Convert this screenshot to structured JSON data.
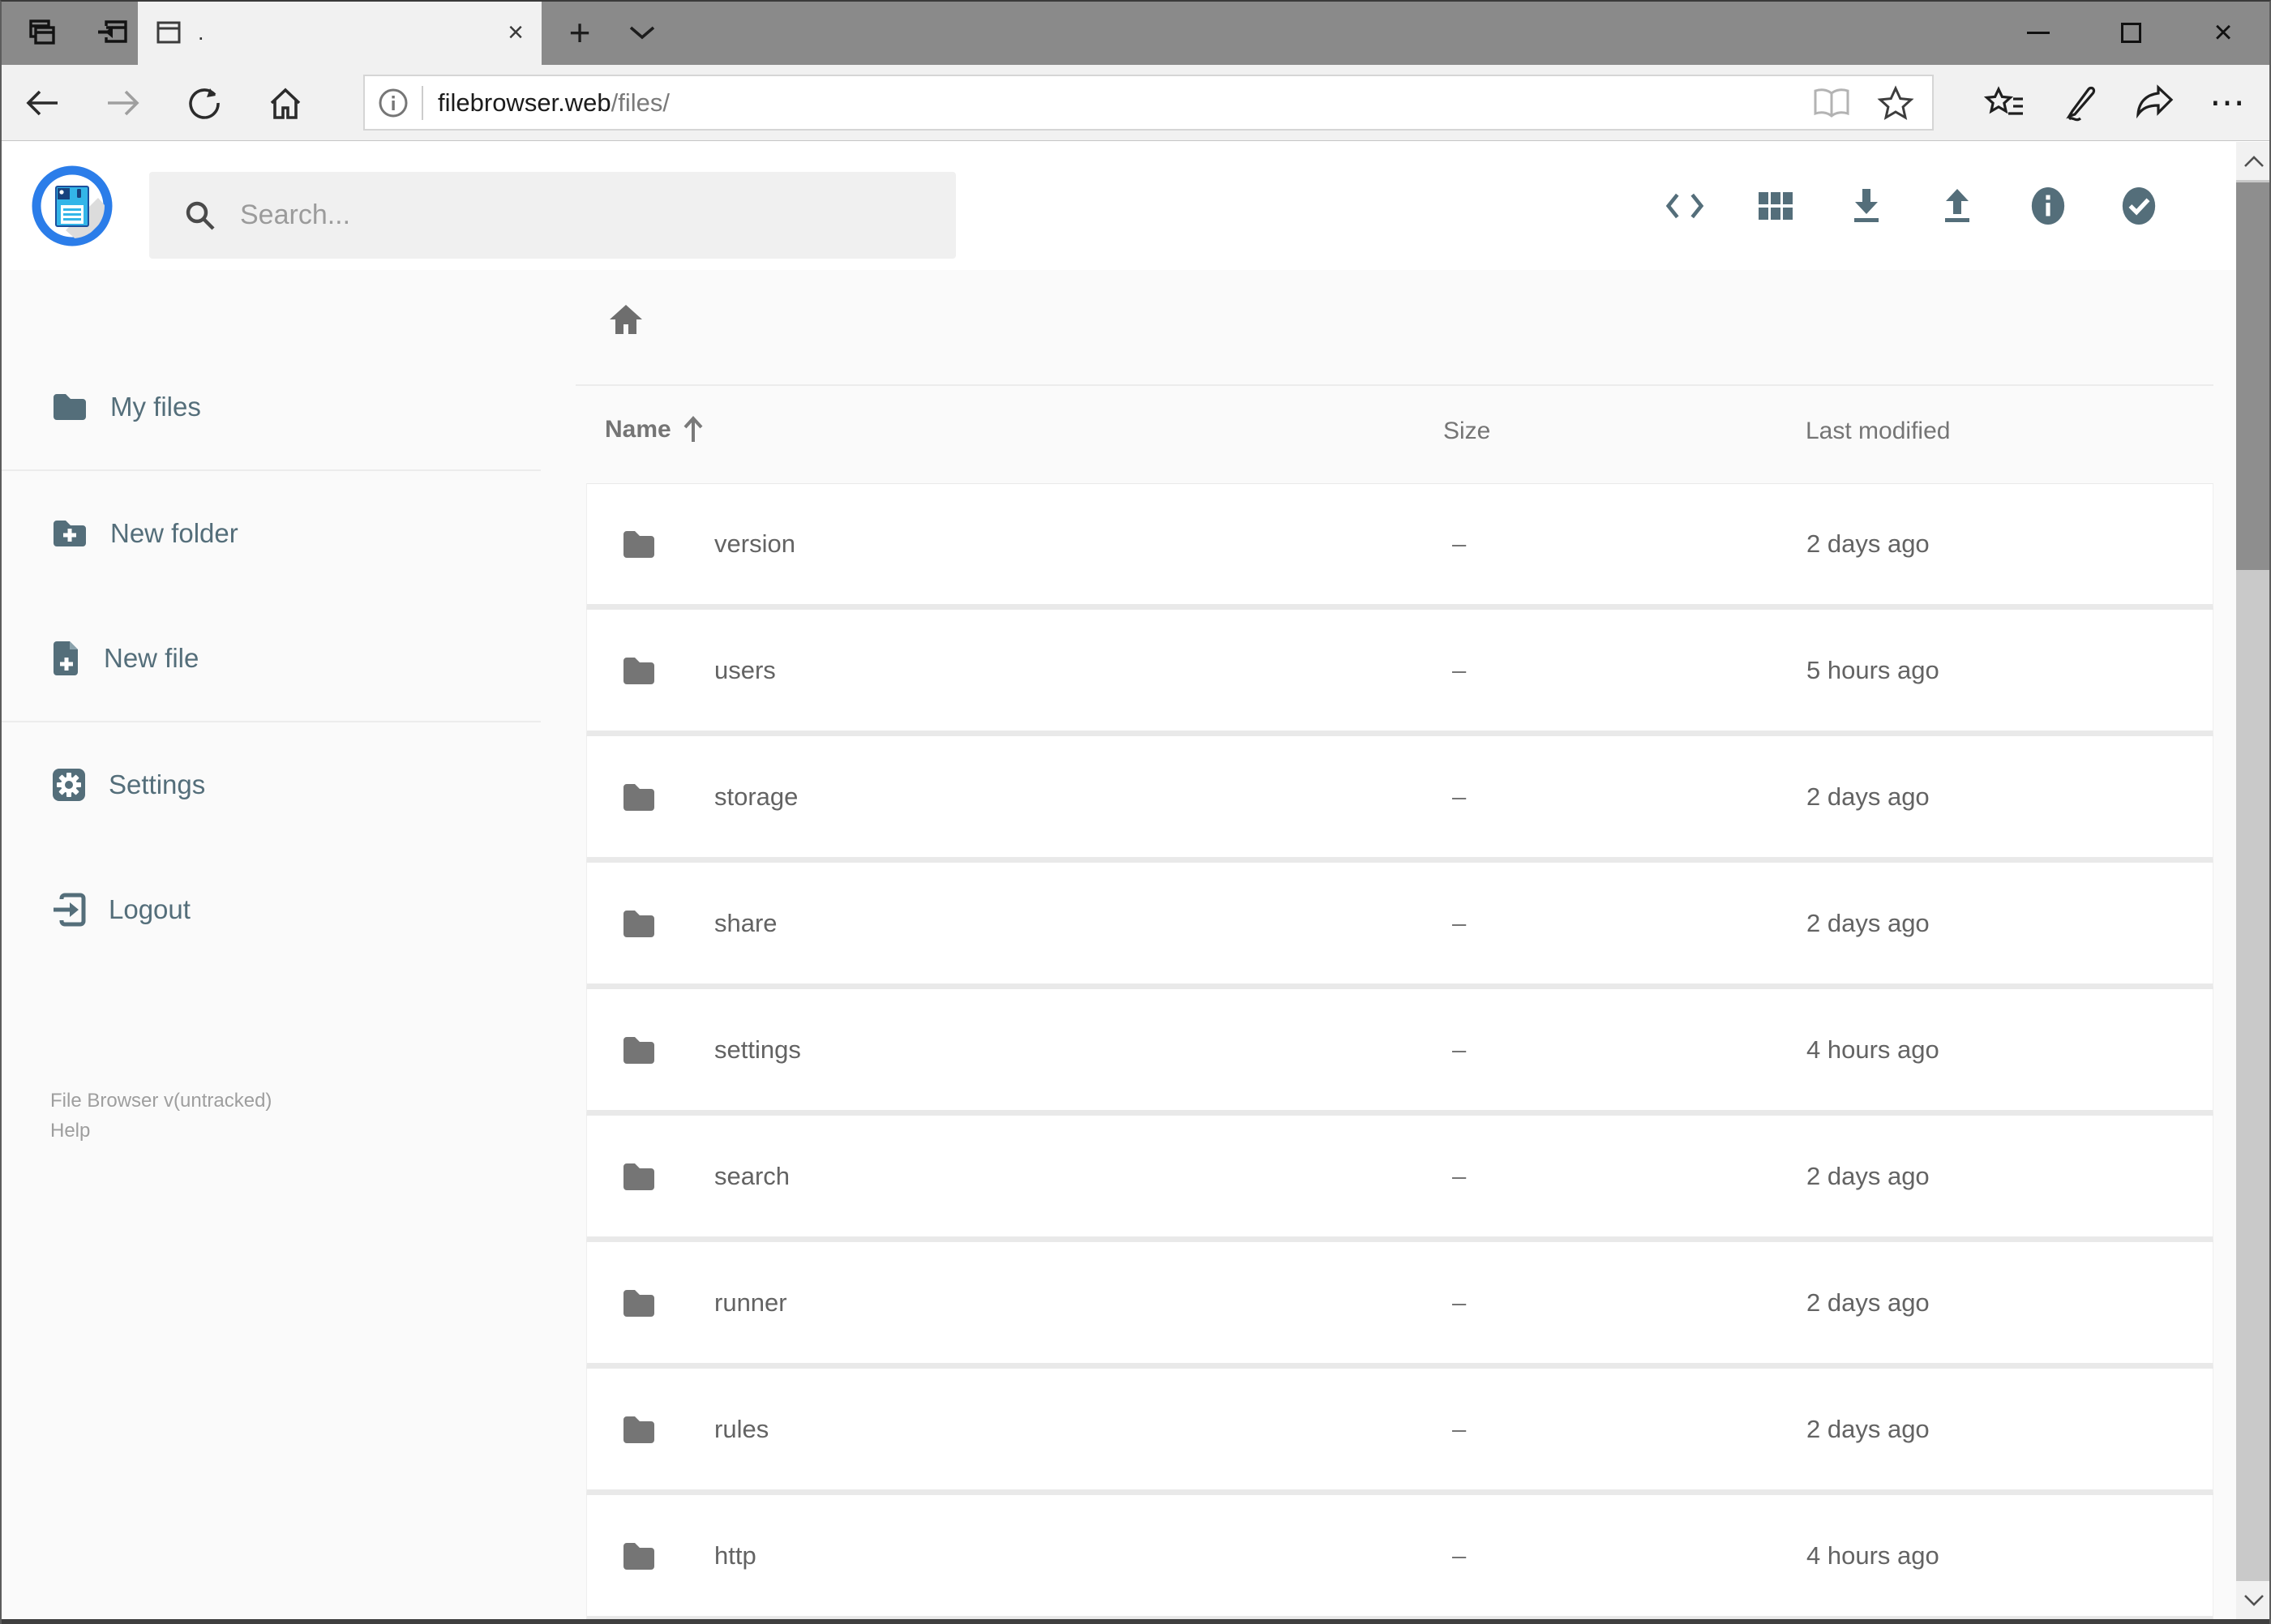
{
  "window": {
    "tab_title": ".",
    "tab_close_glyph": "×",
    "new_tab_glyph": "+",
    "close_window_glyph": "×"
  },
  "browser": {
    "url_host": "filebrowser.web",
    "url_path": "/files/",
    "more_glyph": "⋯"
  },
  "app": {
    "search_placeholder": "Search...",
    "sidebar": {
      "items": [
        {
          "label": "My files"
        },
        {
          "label": "New folder"
        },
        {
          "label": "New file"
        },
        {
          "label": "Settings"
        },
        {
          "label": "Logout"
        }
      ],
      "footer_version": "File Browser v(untracked)",
      "footer_help": "Help"
    },
    "listing": {
      "columns": {
        "name": "Name",
        "size": "Size",
        "modified": "Last modified"
      },
      "sort": {
        "column": "Name",
        "direction": "ascending"
      },
      "rows": [
        {
          "name": "version",
          "size": "–",
          "modified": "2 days ago"
        },
        {
          "name": "users",
          "size": "–",
          "modified": "5 hours ago"
        },
        {
          "name": "storage",
          "size": "–",
          "modified": "2 days ago"
        },
        {
          "name": "share",
          "size": "–",
          "modified": "2 days ago"
        },
        {
          "name": "settings",
          "size": "–",
          "modified": "4 hours ago"
        },
        {
          "name": "search",
          "size": "–",
          "modified": "2 days ago"
        },
        {
          "name": "runner",
          "size": "–",
          "modified": "2 days ago"
        },
        {
          "name": "rules",
          "size": "–",
          "modified": "2 days ago"
        },
        {
          "name": "http",
          "size": "–",
          "modified": "4 hours ago"
        }
      ]
    }
  },
  "icons": {
    "titlebar": [
      "tab-preview-icon",
      "set-tabs-aside-icon"
    ],
    "toolbar": [
      "back-icon",
      "forward-icon",
      "refresh-icon",
      "home-icon",
      "info-icon",
      "reading-view-icon",
      "favorite-star-icon",
      "hub-icon",
      "annotate-pen-icon",
      "share-icon",
      "more-icon"
    ],
    "header": [
      "code-editor-icon",
      "grid-view-icon",
      "download-icon",
      "upload-icon",
      "info-circle-icon",
      "select-check-icon"
    ]
  },
  "colors": {
    "accent": "#546e7a",
    "logo_ring": "#2b7de9",
    "logo_disk": "#33b5e8",
    "titlebar": "#8a8a8a",
    "chrome": "#f1f1f1",
    "row_bg": "#ffffff",
    "page_bg": "#fafafa"
  }
}
